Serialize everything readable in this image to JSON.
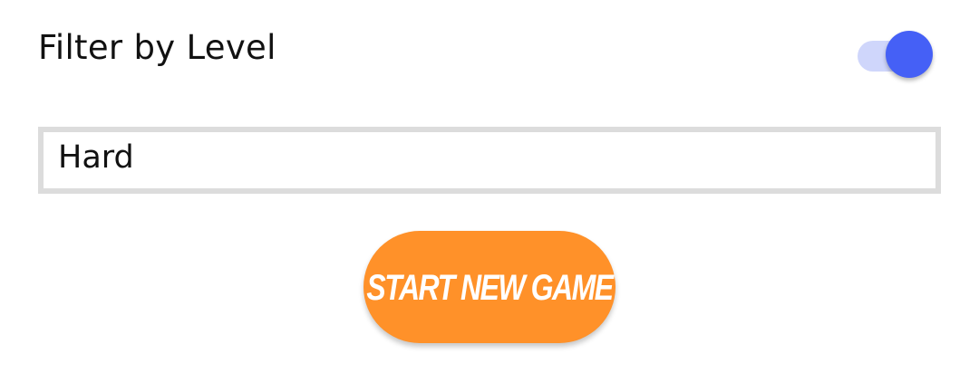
{
  "filter": {
    "label": "Filter by Level",
    "toggle_on": true,
    "toggle_track_color": "#cfd6fb",
    "toggle_thumb_color": "#4560f6"
  },
  "level_select": {
    "value": "Hard"
  },
  "start_button": {
    "label": "START NEW GAME",
    "color": "#ff9129"
  }
}
